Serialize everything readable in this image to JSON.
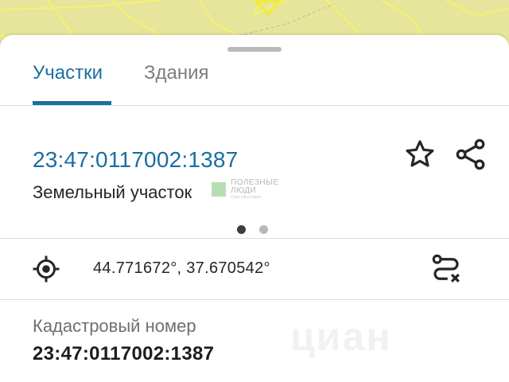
{
  "map": {
    "background": "#e6e59c",
    "line_color": "#f7f26a"
  },
  "tabs": [
    {
      "label": "Участки",
      "active": true
    },
    {
      "label": "Здания",
      "active": false
    }
  ],
  "object": {
    "cadastral_number_link": "23:47:0117002:1387",
    "type": "Земельный участок",
    "watermark_line1": "ПОЛЕЗНЫЕ",
    "watermark_line2": "ЛЮДИ",
    "watermark_sub": "Союз риэлторов",
    "pager": {
      "pages": 2,
      "current": 1
    },
    "actions": [
      "star-icon",
      "share-icon"
    ]
  },
  "coordinates": {
    "text": "44.771672°, 37.670542°",
    "left_icon": "crosshair-icon",
    "right_icon": "route-cancel-icon"
  },
  "watermark_brand": "циан",
  "info": {
    "label": "Кадастровый номер",
    "value": "23:47:0117002:1387"
  },
  "colors": {
    "accent": "#1a6ea0",
    "text": "#262626",
    "muted": "#7d7d7d"
  }
}
